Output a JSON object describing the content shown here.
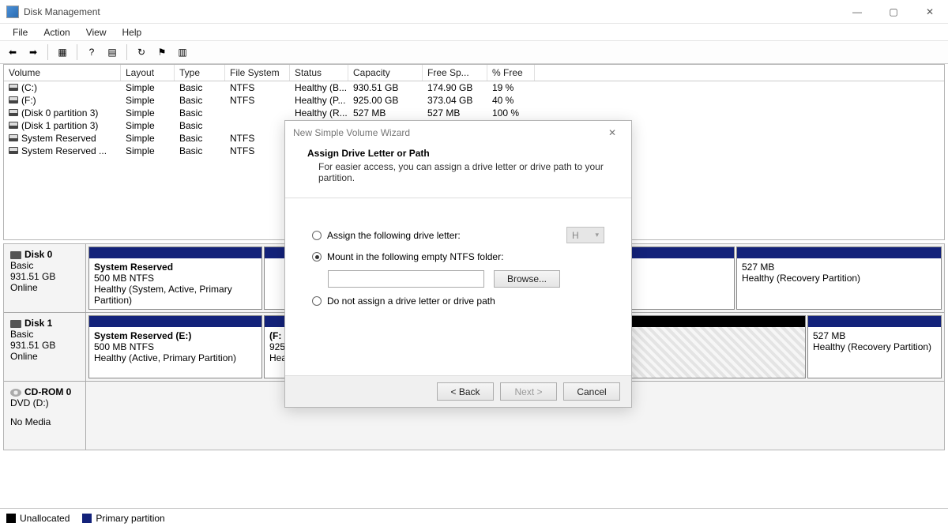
{
  "window": {
    "title": "Disk Management",
    "min": "—",
    "max": "▢",
    "close": "✕"
  },
  "menu": {
    "file": "File",
    "action": "Action",
    "view": "View",
    "help": "Help"
  },
  "columns": {
    "volume": "Volume",
    "layout": "Layout",
    "type": "Type",
    "fs": "File System",
    "status": "Status",
    "cap": "Capacity",
    "free": "Free Sp...",
    "pf": "% Free"
  },
  "volumes": [
    {
      "name": "(C:)",
      "layout": "Simple",
      "type": "Basic",
      "fs": "NTFS",
      "status": "Healthy (B...",
      "cap": "930.51 GB",
      "free": "174.90 GB",
      "pf": "19 %"
    },
    {
      "name": "(F:)",
      "layout": "Simple",
      "type": "Basic",
      "fs": "NTFS",
      "status": "Healthy (P...",
      "cap": "925.00 GB",
      "free": "373.04 GB",
      "pf": "40 %"
    },
    {
      "name": "(Disk 0 partition 3)",
      "layout": "Simple",
      "type": "Basic",
      "fs": "",
      "status": "Healthy (R...",
      "cap": "527 MB",
      "free": "527 MB",
      "pf": "100 %"
    },
    {
      "name": "(Disk 1 partition 3)",
      "layout": "Simple",
      "type": "Basic",
      "fs": "",
      "status": "",
      "cap": "",
      "free": "",
      "pf": ""
    },
    {
      "name": "System Reserved",
      "layout": "Simple",
      "type": "Basic",
      "fs": "NTFS",
      "status": "",
      "cap": "",
      "free": "",
      "pf": ""
    },
    {
      "name": "System Reserved ...",
      "layout": "Simple",
      "type": "Basic",
      "fs": "NTFS",
      "status": "",
      "cap": "",
      "free": "",
      "pf": ""
    }
  ],
  "disks": {
    "d0": {
      "name": "Disk 0",
      "type": "Basic",
      "size": "931.51 GB",
      "state": "Online",
      "p0": {
        "name": "System Reserved",
        "info": "500 MB NTFS",
        "status": "Healthy (System, Active, Primary Partition)"
      },
      "p2": {
        "name": "",
        "info": "527 MB",
        "status": "Healthy (Recovery Partition)"
      }
    },
    "d1": {
      "name": "Disk 1",
      "type": "Basic",
      "size": "931.51 GB",
      "state": "Online",
      "p0": {
        "name": "System Reserved  (E:)",
        "info": "500 MB NTFS",
        "status": "Healthy (Active, Primary Partition)"
      },
      "p1": {
        "name": "(F:",
        "info": "925",
        "status": "Hea"
      },
      "p3": {
        "name": "",
        "info": "527 MB",
        "status": "Healthy (Recovery Partition)"
      }
    },
    "cd": {
      "name": "CD-ROM 0",
      "type": "DVD (D:)",
      "state": "No Media"
    }
  },
  "legend": {
    "unalloc": "Unallocated",
    "primary": "Primary partition"
  },
  "dialog": {
    "title": "New Simple Volume Wizard",
    "heading": "Assign Drive Letter or Path",
    "sub": "For easier access, you can assign a drive letter or drive path to your partition.",
    "opt1": "Assign the following drive letter:",
    "letter": "H",
    "opt2": "Mount in the following empty NTFS folder:",
    "browse": "Browse...",
    "opt3": "Do not assign a drive letter or drive path",
    "back": "< Back",
    "next": "Next >",
    "cancel": "Cancel"
  }
}
